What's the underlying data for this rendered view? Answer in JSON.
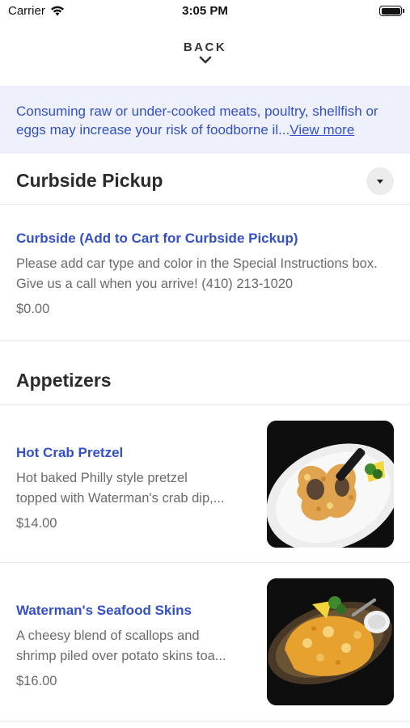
{
  "status_bar": {
    "carrier": "Carrier",
    "time": "3:05 PM"
  },
  "nav": {
    "back_label": "BACK"
  },
  "warning": {
    "text": "Consuming raw or under-cooked meats, poultry, shellfish or eggs may increase your risk of foodborne il...",
    "link": "View more"
  },
  "sections": {
    "curbside": {
      "title": "Curbside Pickup",
      "item": {
        "name": "Curbside (Add to Cart for Curbside Pickup)",
        "description": "Please add car type and color in the Special Instructions box. Give us a call when you arrive! (410) 213-1020",
        "price": "$0.00"
      }
    },
    "appetizers": {
      "title": "Appetizers",
      "items": [
        {
          "name": "Hot Crab Pretzel",
          "description_line1": "Hot baked Philly style pretzel",
          "description_line2": "topped with Waterman's crab dip,...",
          "price": "$14.00"
        },
        {
          "name": "Waterman's Seafood Skins",
          "description_line1": "A cheesy blend of scallops and",
          "description_line2": "shrimp piled over potato skins toa...",
          "price": "$16.00"
        }
      ]
    }
  },
  "icons": {
    "wifi": "wifi-icon",
    "battery": "battery-icon",
    "back_chevron": "chevron-down-icon",
    "dropdown": "caret-down-icon"
  },
  "colors": {
    "accent": "#3350c8",
    "warning_bg": "#eef1fb",
    "muted_text": "#6b6b6b"
  }
}
